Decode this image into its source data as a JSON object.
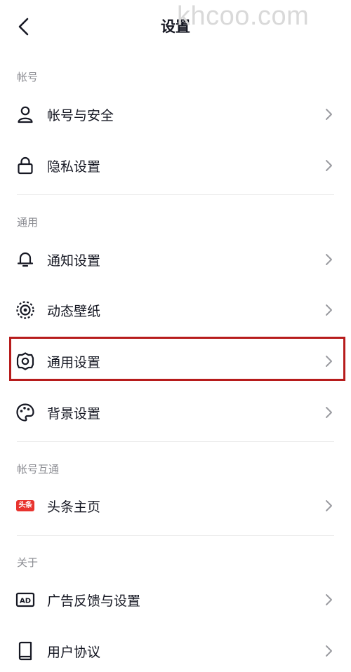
{
  "header": {
    "title": "设置",
    "watermark": "khcoo.com"
  },
  "sections": [
    {
      "label": "帐号",
      "items": [
        {
          "label": "帐号与安全",
          "icon": "person-icon"
        },
        {
          "label": "隐私设置",
          "icon": "lock-icon"
        }
      ]
    },
    {
      "label": "通用",
      "items": [
        {
          "label": "通知设置",
          "icon": "bell-icon"
        },
        {
          "label": "动态壁纸",
          "icon": "live-wallpaper-icon"
        },
        {
          "label": "通用设置",
          "icon": "gear-icon",
          "highlighted": true
        },
        {
          "label": "背景设置",
          "icon": "palette-icon"
        }
      ]
    },
    {
      "label": "帐号互通",
      "items": [
        {
          "label": "头条主页",
          "icon": "toutiao-icon",
          "badge_text": "头条"
        }
      ]
    },
    {
      "label": "关于",
      "items": [
        {
          "label": "广告反馈与设置",
          "icon": "ad-icon",
          "icon_text": "AD"
        },
        {
          "label": "用户协议",
          "icon": "book-icon"
        }
      ]
    }
  ],
  "colors": {
    "text": "#161823",
    "section_label": "#8a8b91",
    "chevron": "#9a9ba0",
    "highlight_border": "#b71c1c",
    "toutiao_red": "#e8332e"
  }
}
